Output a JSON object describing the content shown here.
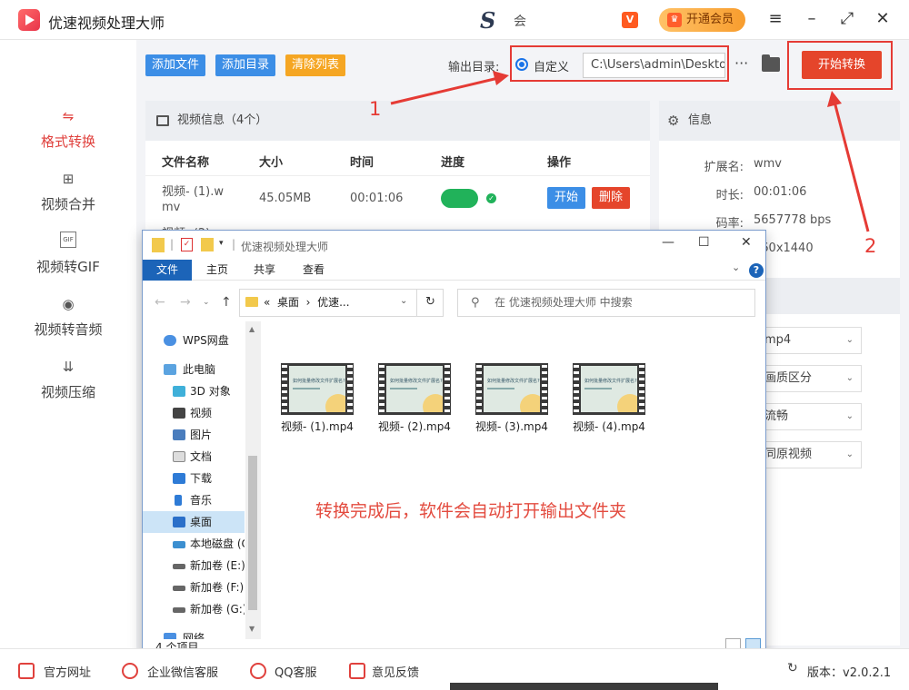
{
  "app": {
    "title": "优速视频处理大师",
    "user_name": "会",
    "vip_button": "开通会员",
    "vip_icon_text": "V",
    "user_logo_glyph": "S",
    "minimize": "–",
    "maximize": "⤢",
    "close": "✕",
    "menu": "≡"
  },
  "sidebar": {
    "items": [
      {
        "label": "格式转换",
        "icon": "⇋"
      },
      {
        "label": "视频合并",
        "icon": "⊞"
      },
      {
        "label": "视频转GIF",
        "icon": "GIF"
      },
      {
        "label": "视频转音频",
        "icon": "◉"
      },
      {
        "label": "视频压缩",
        "icon": "⇊"
      }
    ]
  },
  "toolbar": {
    "add_file": "添加文件",
    "add_dir": "添加目录",
    "clear_list": "清除列表",
    "output_label": "输出目录:",
    "custom": "自定义",
    "path": "C:\\Users\\admin\\Deskto",
    "more": "···",
    "start": "开始转换"
  },
  "video_panel": {
    "title": "视频信息（4个）",
    "columns": [
      "文件名称",
      "大小",
      "时间",
      "进度",
      "操作"
    ],
    "rows": [
      {
        "name_line1": "视频- (1).w",
        "name_line2": "mv",
        "size": "45.05MB",
        "time": "00:01:06",
        "start": "开始",
        "delete": "删除"
      },
      {
        "name_line1": "视频- (2).w"
      }
    ]
  },
  "info_panel": {
    "title": "信息",
    "rows": [
      {
        "key": "扩展名:",
        "value": "wmv"
      },
      {
        "key": "时长:",
        "value": "00:01:06"
      },
      {
        "key": "码率:",
        "value": "5657778 bps"
      },
      {
        "key": "",
        "value": "560x1440"
      }
    ],
    "selects": [
      "mp4",
      "画质区分",
      "流畅",
      "同原视频"
    ]
  },
  "explorer": {
    "title": "优速视频处理大师",
    "ribbon_tabs": [
      "文件",
      "主页",
      "共享",
      "查看"
    ],
    "address": [
      "«",
      "桌面",
      "›",
      "优速..."
    ],
    "search_placeholder": "在 优速视频处理大师 中搜索",
    "nav_items": [
      "WPS网盘",
      "此电脑",
      "3D 对象",
      "视频",
      "图片",
      "文档",
      "下载",
      "音乐",
      "桌面",
      "本地磁盘 (C",
      "新加卷 (E:)",
      "新加卷 (F:)",
      "新加卷 (G:)",
      "网络"
    ],
    "files": [
      "视频- (1).mp4",
      "视频- (2).mp4",
      "视频- (3).mp4",
      "视频- (4).mp4"
    ],
    "thumb_text": "如何批量修改文件扩展名?",
    "note": "转换完成后，软件会自动打开输出文件夹",
    "status": "4 个项目"
  },
  "annotations": {
    "one": "1",
    "two": "2"
  },
  "footer": {
    "items": [
      "官方网址",
      "企业微信客服",
      "QQ客服",
      "意见反馈"
    ],
    "version": "版本：v2.0.2.1"
  },
  "colors": {
    "accent_red": "#e5452b",
    "blue": "#3c8ee6",
    "orange": "#f5a623",
    "green": "#21b25a"
  }
}
